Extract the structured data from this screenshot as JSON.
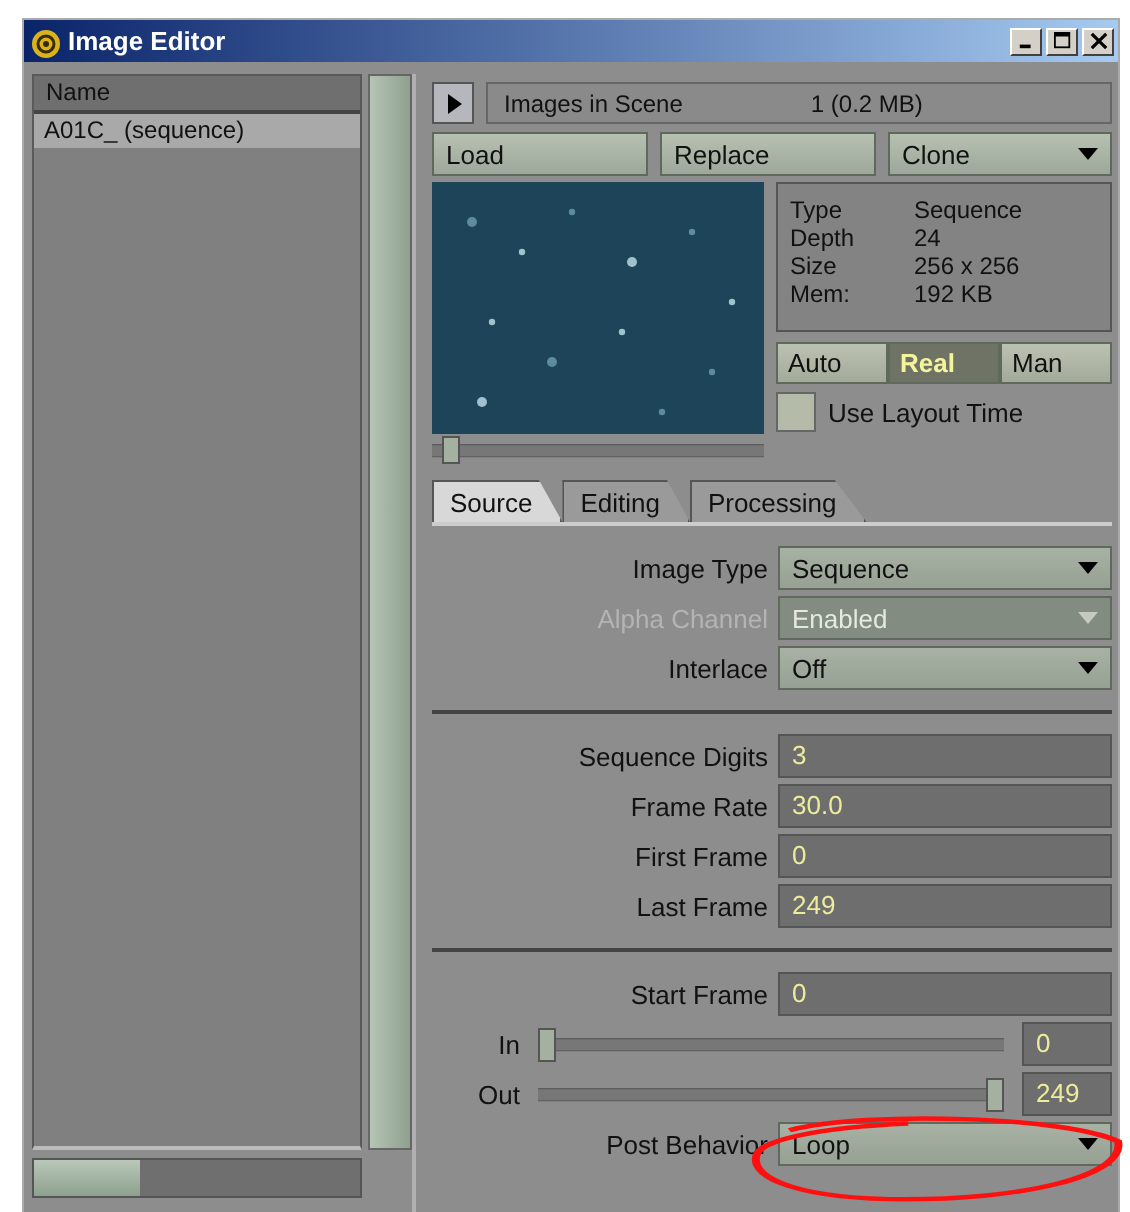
{
  "window": {
    "title": "Image Editor"
  },
  "image_list": {
    "column": "Name",
    "items": [
      {
        "name": "A01C_ (sequence)",
        "selected": true
      }
    ]
  },
  "images_in_scene": {
    "label": "Images in Scene",
    "value": "1 (0.2 MB)"
  },
  "buttons": [
    {
      "label": "Load",
      "kind": "button"
    },
    {
      "label": "Replace",
      "kind": "button"
    },
    {
      "label": "Clone",
      "kind": "menu"
    }
  ],
  "preview": {
    "kind": "picture",
    "level": 0.03
  },
  "info": [
    {
      "label": "Type",
      "value": "Sequence"
    },
    {
      "label": "Depth",
      "value": "24"
    },
    {
      "label": "Size",
      "value": "256 x 256"
    },
    {
      "label": "Mem:",
      "value": "192 KB"
    }
  ],
  "timing_modes": [
    {
      "label": "Auto",
      "selected": false
    },
    {
      "label": "Real",
      "selected": true
    },
    {
      "label": "Man",
      "selected": false
    }
  ],
  "use_layout_time": {
    "label": "Use Layout Time",
    "checked": false
  },
  "tabs": [
    {
      "label": "Source",
      "selected": true
    },
    {
      "label": "Editing",
      "selected": false
    },
    {
      "label": "Processing",
      "selected": false
    }
  ],
  "sections": [
    [
      {
        "kind": "dropdown",
        "label": "Image Type",
        "value": "Sequence",
        "disabled": false
      },
      {
        "kind": "dropdown",
        "label": "Alpha Channel",
        "value": "Enabled",
        "disabled": true
      },
      {
        "kind": "dropdown",
        "label": "Interlace",
        "value": "Off",
        "disabled": false
      }
    ],
    [
      {
        "kind": "number",
        "label": "Sequence Digits",
        "value": "3"
      },
      {
        "kind": "number",
        "label": "Frame Rate",
        "value": "30.0"
      },
      {
        "kind": "number",
        "label": "First Frame",
        "value": "0"
      },
      {
        "kind": "number",
        "label": "Last Frame",
        "value": "249"
      }
    ],
    [
      {
        "kind": "number",
        "label": "Start Frame",
        "value": "0"
      },
      {
        "kind": "slider",
        "label": "In",
        "value": "0",
        "level": 0
      },
      {
        "kind": "slider",
        "label": "Out",
        "value": "249",
        "level": 1
      },
      {
        "kind": "dropdown",
        "label": "Post Behavior",
        "value": "Loop",
        "disabled": false
      }
    ]
  ]
}
